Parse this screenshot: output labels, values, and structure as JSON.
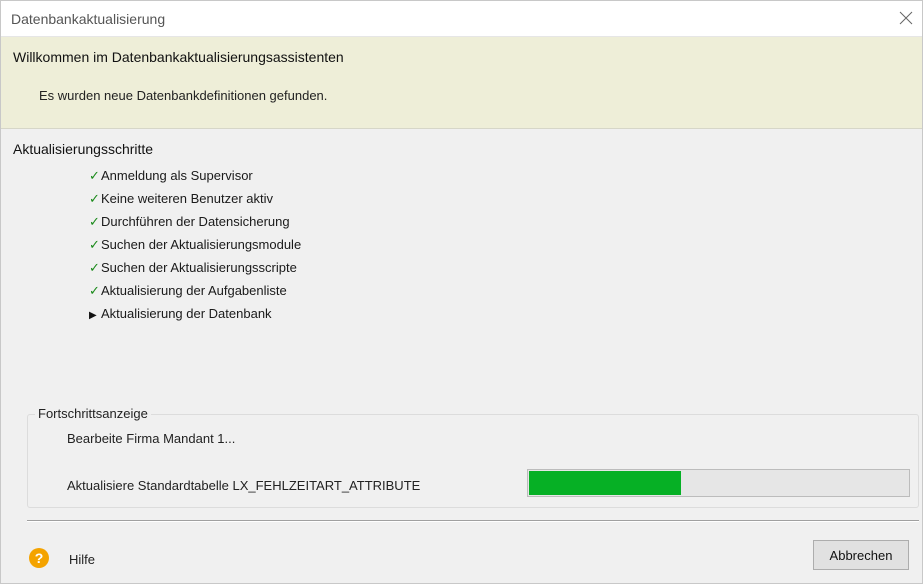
{
  "window": {
    "title": "Datenbankaktualisierung"
  },
  "header": {
    "title": "Willkommen im Datenbankaktualisierungsassistenten",
    "subtitle": "Es wurden neue Datenbankdefinitionen gefunden."
  },
  "steps": {
    "title": "Aktualisierungsschritte",
    "items": [
      {
        "label": "Anmeldung als Supervisor",
        "status": "done",
        "icon": "checkmark-icon"
      },
      {
        "label": "Keine weiteren Benutzer aktiv",
        "status": "done",
        "icon": "checkmark-icon"
      },
      {
        "label": "Durchführen der Datensicherung",
        "status": "done",
        "icon": "checkmark-icon"
      },
      {
        "label": "Suchen der Aktualisierungsmodule",
        "status": "done",
        "icon": "checkmark-icon"
      },
      {
        "label": "Suchen der Aktualisierungsscripte",
        "status": "done",
        "icon": "checkmark-icon"
      },
      {
        "label": "Aktualisierung der Aufgabenliste",
        "status": "done",
        "icon": "checkmark-icon"
      },
      {
        "label": "Aktualisierung der Datenbank",
        "status": "current",
        "icon": "arrow-right-icon"
      }
    ]
  },
  "progress": {
    "group_label": "Fortschrittsanzeige",
    "firma": "Bearbeite Firma Mandant 1...",
    "tabelle": "Aktualisiere Standardtabelle LX_FEHLZEITART_ATTRIBUTE",
    "fraction": 0.4,
    "color": "#06b025"
  },
  "footer": {
    "help_label": "Hilfe",
    "help_icon": "help-icon",
    "cancel_label": "Abbrechen"
  }
}
